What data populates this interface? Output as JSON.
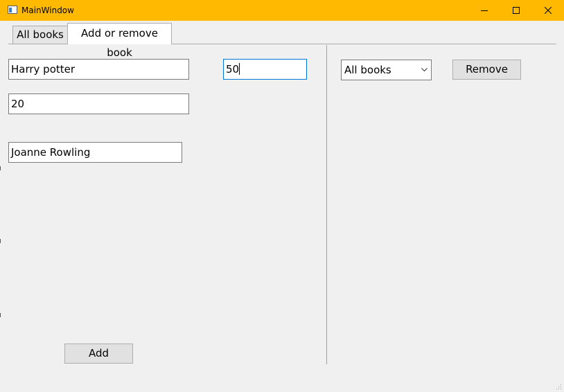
{
  "window": {
    "title": "MainWindow",
    "accent_color": "#ffb900"
  },
  "tabs": [
    {
      "label": "All books",
      "selected": false
    },
    {
      "label": "Add or remove book",
      "selected": true
    }
  ],
  "add_panel": {
    "title_field": {
      "value": "Harry potter"
    },
    "price_field": {
      "value": "50",
      "focused": true
    },
    "quantity_field": {
      "value": "20"
    },
    "author_field": {
      "value": "Joanne Rowling"
    },
    "add_button": {
      "label": "Add"
    }
  },
  "remove_panel": {
    "book_select": {
      "selected": "All books"
    },
    "remove_button": {
      "label": "Remove"
    }
  },
  "icons": {
    "app": "window-app-icon",
    "minimize": "minimize-icon",
    "maximize": "maximize-icon",
    "close": "close-icon",
    "dropdown": "chevron-down-icon",
    "resize": "resize-grip-icon"
  }
}
